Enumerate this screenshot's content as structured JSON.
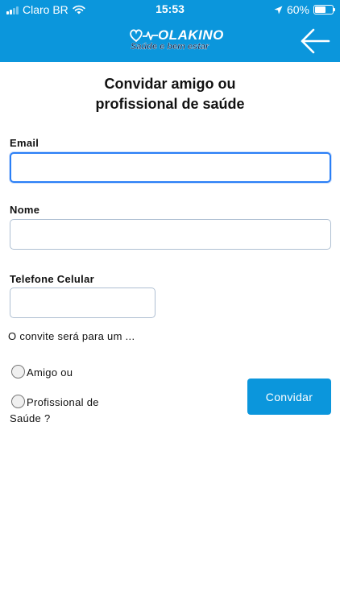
{
  "status_bar": {
    "carrier": "Claro BR",
    "time": "15:53",
    "battery_percent": "60%",
    "battery_level": 0.6
  },
  "header": {
    "logo_word": "OLAKINO",
    "logo_tagline": "Saúde e bem estar",
    "back_icon": "arrow-left-icon",
    "background_color": "#0b96dc"
  },
  "form": {
    "title_line1": "Convidar amigo ou",
    "title_line2": "profissional de saúde",
    "email": {
      "label": "Email",
      "value": ""
    },
    "name": {
      "label": "Nome",
      "value": ""
    },
    "phone": {
      "label": "Telefone Celular",
      "value": ""
    },
    "question": "O convite será para um ...",
    "options": [
      {
        "label": "Amigo ou",
        "checked": false
      },
      {
        "label_line1": "Profissional de",
        "label_line2": "Saúde ?",
        "checked": false
      }
    ],
    "submit_label": "Convidar"
  }
}
